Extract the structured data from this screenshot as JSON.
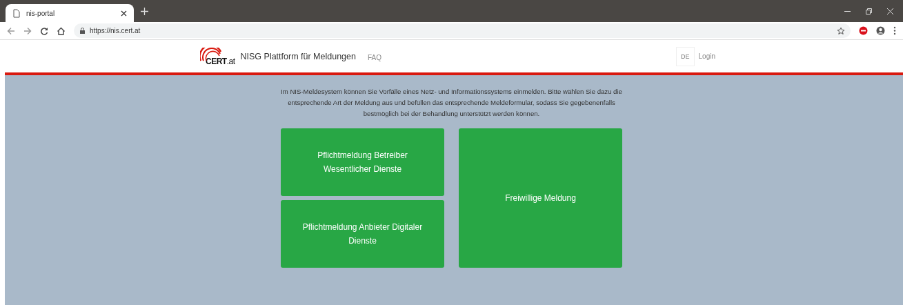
{
  "browser": {
    "tab": {
      "title": "nis-portal",
      "selected": true
    },
    "url": "https://nis.cert.at"
  },
  "header": {
    "logo": "**CERT**.at",
    "title": "NISG Plattform für Meldungen",
    "nav": [
      {
        "label": "FAQ"
      }
    ],
    "language": "DE",
    "login": "Login"
  },
  "intro": "Im NIS-Meldesystem können Sie Vorfälle eines Netz- und Informationssystems einmelden. Bitte wählen Sie dazu die entsprechende Art der Meldung aus und befüllen das entsprechende Meldeformular, sodass Sie gegebenenfalls bestmöglich bei der Behandlung unterstützt werden können.",
  "tiles": [
    {
      "label": "Pflichtmeldung Betreiber Wesentlicher Dienste",
      "kind": "half"
    },
    {
      "label": "Pflichtmeldung Anbieter Digitaler Dienste",
      "kind": "half"
    },
    {
      "label": "Freiwillige Meldung",
      "kind": "full"
    }
  ]
}
